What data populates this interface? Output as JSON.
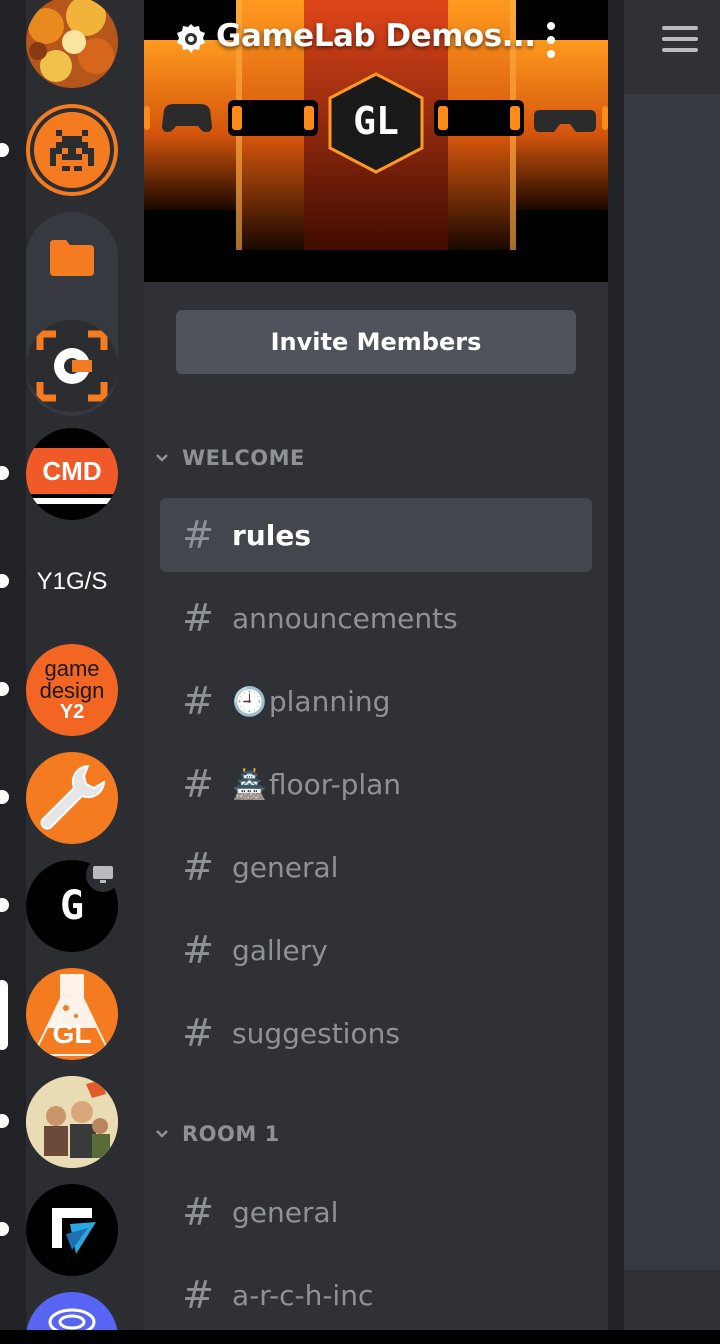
{
  "guild": {
    "name": "GameLab Demos...",
    "banner_label": "GL"
  },
  "invite_button": "Invite Members",
  "categories": [
    {
      "name": "WELCOME",
      "channels": [
        {
          "name": "rules",
          "emoji": "",
          "selected": true
        },
        {
          "name": "announcements",
          "emoji": ""
        },
        {
          "name": "planning",
          "emoji": "🕘"
        },
        {
          "name": "floor-plan",
          "emoji": "🏯"
        },
        {
          "name": "general",
          "emoji": ""
        },
        {
          "name": "gallery",
          "emoji": ""
        },
        {
          "name": "suggestions",
          "emoji": ""
        }
      ]
    },
    {
      "name": "ROOM 1",
      "channels": [
        {
          "name": "general",
          "emoji": ""
        },
        {
          "name": "a-r-c-h-inc",
          "emoji": ""
        }
      ]
    }
  ],
  "servers": {
    "cmd": "CMD",
    "y1gs": "Y1G/S",
    "game_design_line1": "game",
    "game_design_line2": "design",
    "game_design_line3": "Y2",
    "gamelab": "GL",
    "g_server": "G"
  },
  "hash_glyph": "#",
  "colors": {
    "accent_orange": "#f47b20",
    "panel_bg": "#2f3136",
    "rail_bg": "#202225",
    "selected_bg": "#42464d",
    "muted_text": "#8e9297"
  }
}
